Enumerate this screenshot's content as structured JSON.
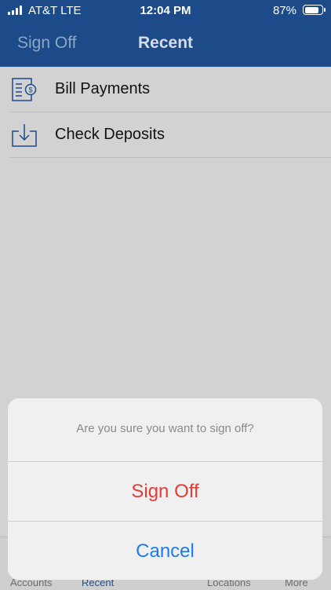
{
  "status_bar": {
    "carrier": "AT&T",
    "network": "LTE",
    "time": "12:04 PM",
    "battery_percent": "87%",
    "battery_level": 0.87
  },
  "nav": {
    "left_button": "Sign Off",
    "title": "Recent"
  },
  "list": {
    "items": [
      {
        "label": "Bill Payments",
        "icon": "bill-payment-icon"
      },
      {
        "label": "Check Deposits",
        "icon": "download-tray-icon"
      }
    ]
  },
  "tab_bar": {
    "tabs": [
      {
        "label": "Accounts"
      },
      {
        "label": "Recent",
        "active": true
      },
      {
        "label": "Locations"
      },
      {
        "label": "More"
      }
    ]
  },
  "action_sheet": {
    "message": "Are you sure you want to sign off?",
    "confirm_label": "Sign Off",
    "cancel_label": "Cancel"
  },
  "colors": {
    "brand_blue": "#1d4b8a",
    "destructive": "#e53c35",
    "action_blue": "#1a7cf0"
  }
}
